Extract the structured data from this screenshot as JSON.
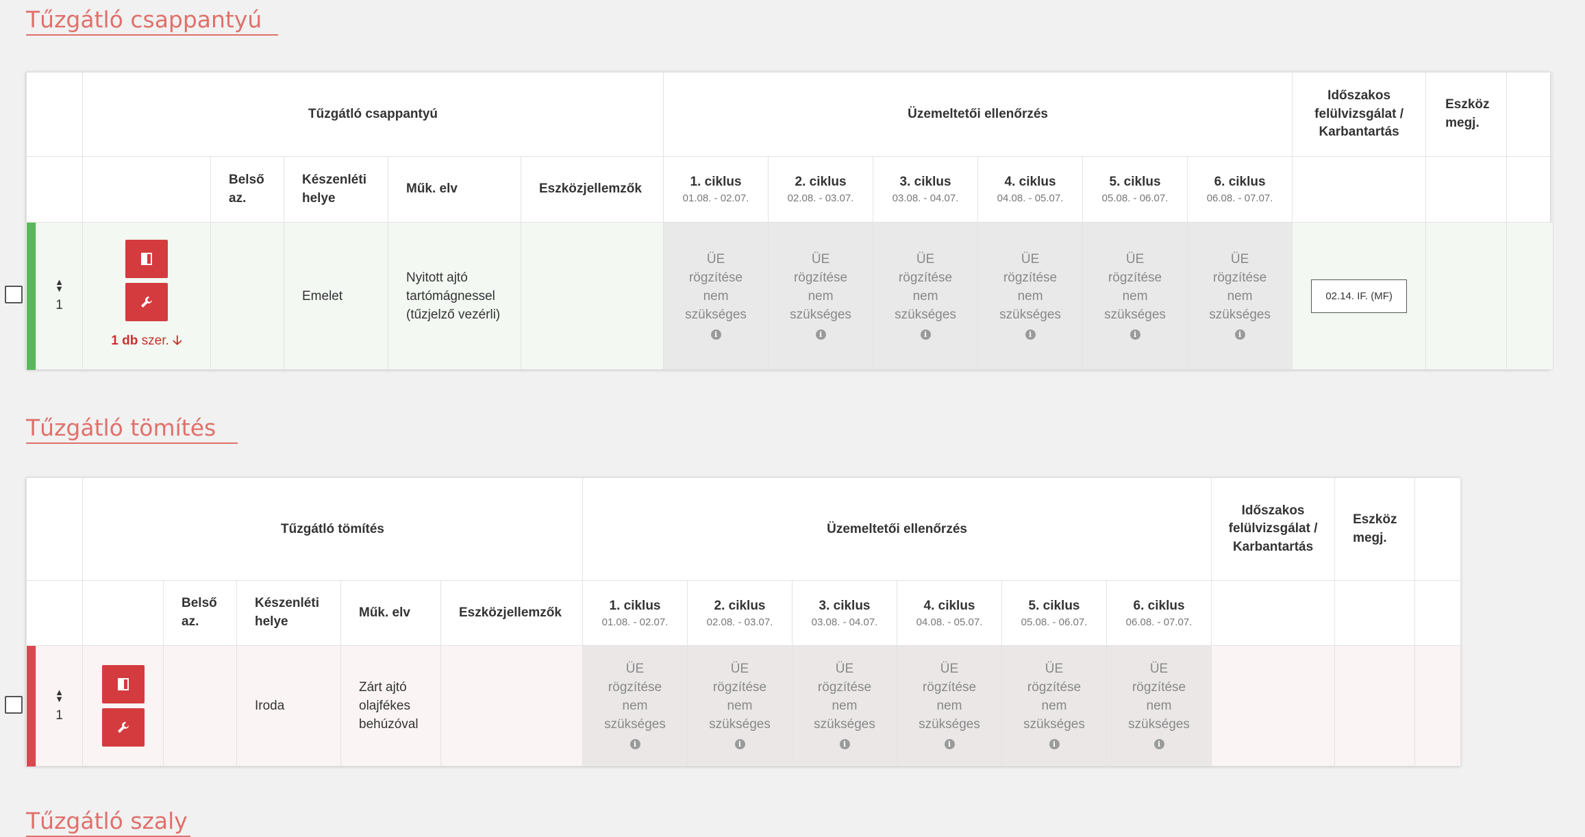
{
  "sections": [
    {
      "title": "Tűzgátló csappantyú",
      "group_main": "Tűzgátló csappantyú",
      "group_check": "Üzemeltetői ellenőrzés",
      "group_periodic": "Időszakos felülvizsgálat / Karbantartás",
      "group_device_note": "Eszköz megj.",
      "columns": {
        "internal_id": "Belső az.",
        "location": "Készenléti helye",
        "operation": "Műk. elv",
        "features": "Eszközjellemzők"
      },
      "cycles": [
        {
          "label": "1. ciklus",
          "range": "01.08. - 02.07."
        },
        {
          "label": "2. ciklus",
          "range": "02.08. - 03.07."
        },
        {
          "label": "3. ciklus",
          "range": "03.08. - 04.07."
        },
        {
          "label": "4. ciklus",
          "range": "04.08. - 05.07."
        },
        {
          "label": "5. ciklus",
          "range": "05.08. - 06.07."
        },
        {
          "label": "6. ciklus",
          "range": "06.08. - 07.07."
        }
      ],
      "row": {
        "status_color": "#5cb85c",
        "order": "1",
        "count_label": "1 db",
        "count_suffix": "szer.",
        "internal_id": "",
        "location": "Emelet",
        "operation": "Nyitott ajtó tartómágnessel (tűzjelző vezérli)",
        "features": "",
        "cycle_status": "ÜE rögzítése nem szükséges",
        "periodic_button": "02.14. IF. (MF)"
      }
    },
    {
      "title": "Tűzgátló tömítés",
      "group_main": "Tűzgátló tömítés",
      "group_check": "Üzemeltetői ellenőrzés",
      "group_periodic": "Időszakos felülvizsgálat / Karbantartás",
      "group_device_note": "Eszköz megj.",
      "columns": {
        "internal_id": "Belső az.",
        "location": "Készenléti helye",
        "operation": "Műk. elv",
        "features": "Eszközjellemzők"
      },
      "cycles": [
        {
          "label": "1. ciklus",
          "range": "01.08. - 02.07."
        },
        {
          "label": "2. ciklus",
          "range": "02.08. - 03.07."
        },
        {
          "label": "3. ciklus",
          "range": "03.08. - 04.07."
        },
        {
          "label": "4. ciklus",
          "range": "04.08. - 05.07."
        },
        {
          "label": "5. ciklus",
          "range": "05.08. - 06.07."
        },
        {
          "label": "6. ciklus",
          "range": "06.08. - 07.07."
        }
      ],
      "row": {
        "status_color": "#d9474f",
        "order": "1",
        "internal_id": "",
        "location": "Iroda",
        "operation": "Zárt ajtó olajfékes behúzóval",
        "features": "",
        "cycle_status": "ÜE rögzítése nem szükséges"
      }
    },
    {
      "title": "Tűzgátló szaly"
    }
  ],
  "icons": {
    "door": "door-icon",
    "wrench": "wrench-icon",
    "sort": "sort-icon",
    "info": "info-icon",
    "arrow_down": "arrow-down-icon"
  },
  "colors": {
    "accent": "#d43b3f",
    "title": "#e0706b",
    "ok": "#5cb85c",
    "fail": "#d9474f"
  }
}
